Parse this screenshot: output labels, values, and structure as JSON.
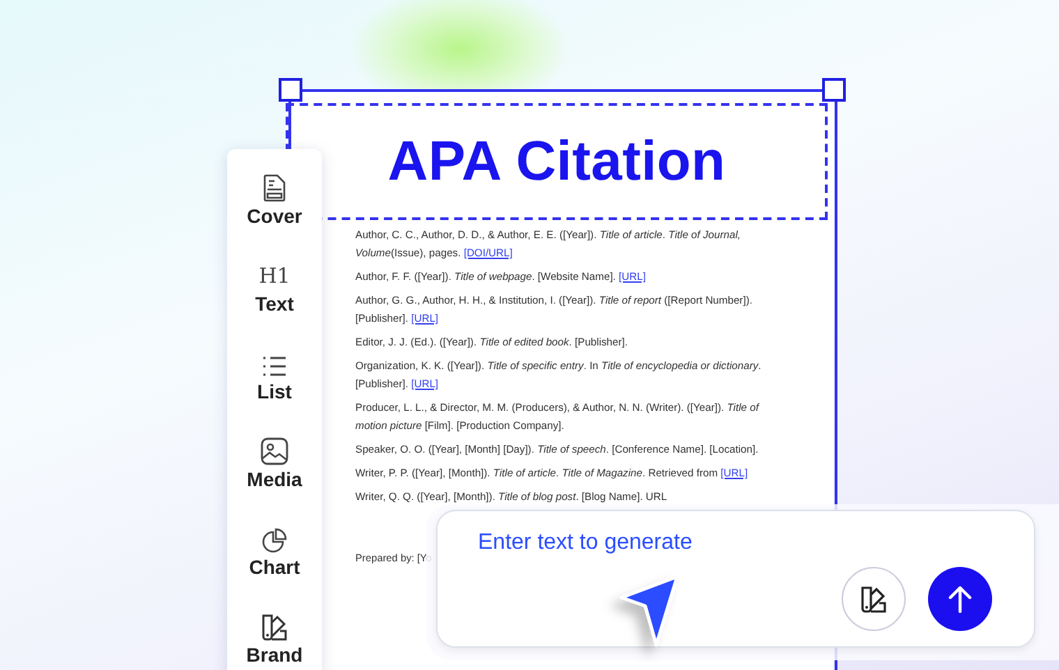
{
  "document": {
    "title": "APA Citation",
    "citations": [
      {
        "text": "Author, C. C., Author, D. D., & Author, E. E. ([Year]). *Title of article*. *Title of Journal, Volume*(Issue), pages.",
        "link": "[DOI/URL]"
      },
      {
        "text": "Author, F. F. ([Year]). *Title of webpage*. [Website Name].",
        "link": "[URL]"
      },
      {
        "text": "Author, G. G., Author, H. H., & Institution, I. ([Year]). *Title of report* ([Report Number]). [Publisher].",
        "link": "[URL]"
      },
      {
        "text": "Editor, J. J. (Ed.). ([Year]). *Title of edited book*. [Publisher]."
      },
      {
        "text": "Organization, K. K. ([Year]). *Title of specific entry*. In *Title of encyclopedia or dictionary*. [Publisher].",
        "link": "[URL]"
      },
      {
        "text": "Producer, L. L., & Director, M. M. (Producers), & Author, N. N. (Writer). ([Year]). *Title of motion picture* [Film]. [Production Company]."
      },
      {
        "text": "Speaker, O. O. ([Year], [Month] [Day]). *Title of speech*. [Conference Name]. [Location]."
      },
      {
        "text": "Writer, P. P. ([Year], [Month]). *Title of article*. *Title of Magazine*. Retrieved from",
        "link": "[URL]"
      },
      {
        "text": "Writer, Q. Q. ([Year], [Month]). *Title of blog post*. [Blog Name]. URL"
      }
    ],
    "footer": "Prepared by: [Yo"
  },
  "sidebar": {
    "items": [
      {
        "label": "Cover"
      },
      {
        "label": "Text",
        "glyph": "H1"
      },
      {
        "label": "List"
      },
      {
        "label": "Media"
      },
      {
        "label": "Chart"
      },
      {
        "label": "Brand"
      }
    ]
  },
  "prompt": {
    "placeholder": "Enter text to generate"
  }
}
